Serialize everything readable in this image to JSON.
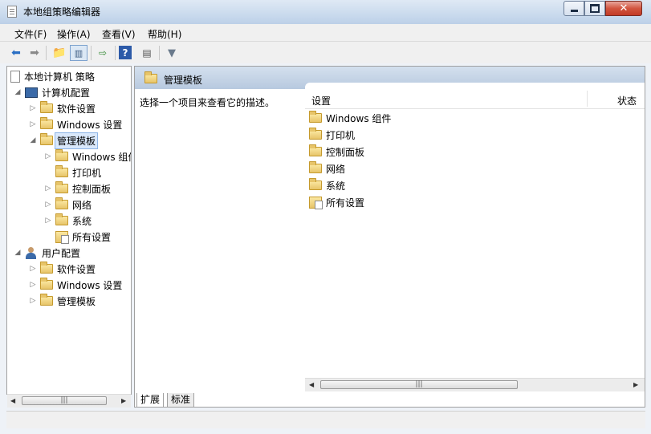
{
  "window": {
    "title": "本地组策略编辑器"
  },
  "menu": [
    "文件(F)",
    "操作(A)",
    "查看(V)",
    "帮助(H)"
  ],
  "toolbar": {
    "back_icon": "arrow-left-icon",
    "forward_icon": "arrow-right-icon",
    "up_icon": "folder-up-icon",
    "show_hide_tree_icon": "tree-pane-icon",
    "export_icon": "export-list-icon",
    "help_icon": "help-icon",
    "properties_icon": "properties-icon",
    "filter_icon": "filter-icon"
  },
  "tree": {
    "root": "本地计算机 策略",
    "computer": "计算机配置",
    "computer_children": [
      "软件设置",
      "Windows 设置",
      "管理模板"
    ],
    "admin_children": [
      "Windows 组件",
      "打印机",
      "控制面板",
      "网络",
      "系统",
      "所有设置"
    ],
    "user": "用户配置",
    "user_children": [
      "软件设置",
      "Windows 设置",
      "管理模板"
    ]
  },
  "right": {
    "header_title": "管理模板",
    "description": "选择一个项目来查看它的描述。",
    "col_setting": "设置",
    "col_status": "状态",
    "items": [
      "Windows 组件",
      "打印机",
      "控制面板",
      "网络",
      "系统",
      "所有设置"
    ]
  },
  "tabs": [
    "扩展",
    "标准"
  ],
  "colors": {
    "title_bg": "#cfdeef",
    "header_bg": "#b7c9df",
    "selection": "#d9e8fb"
  }
}
